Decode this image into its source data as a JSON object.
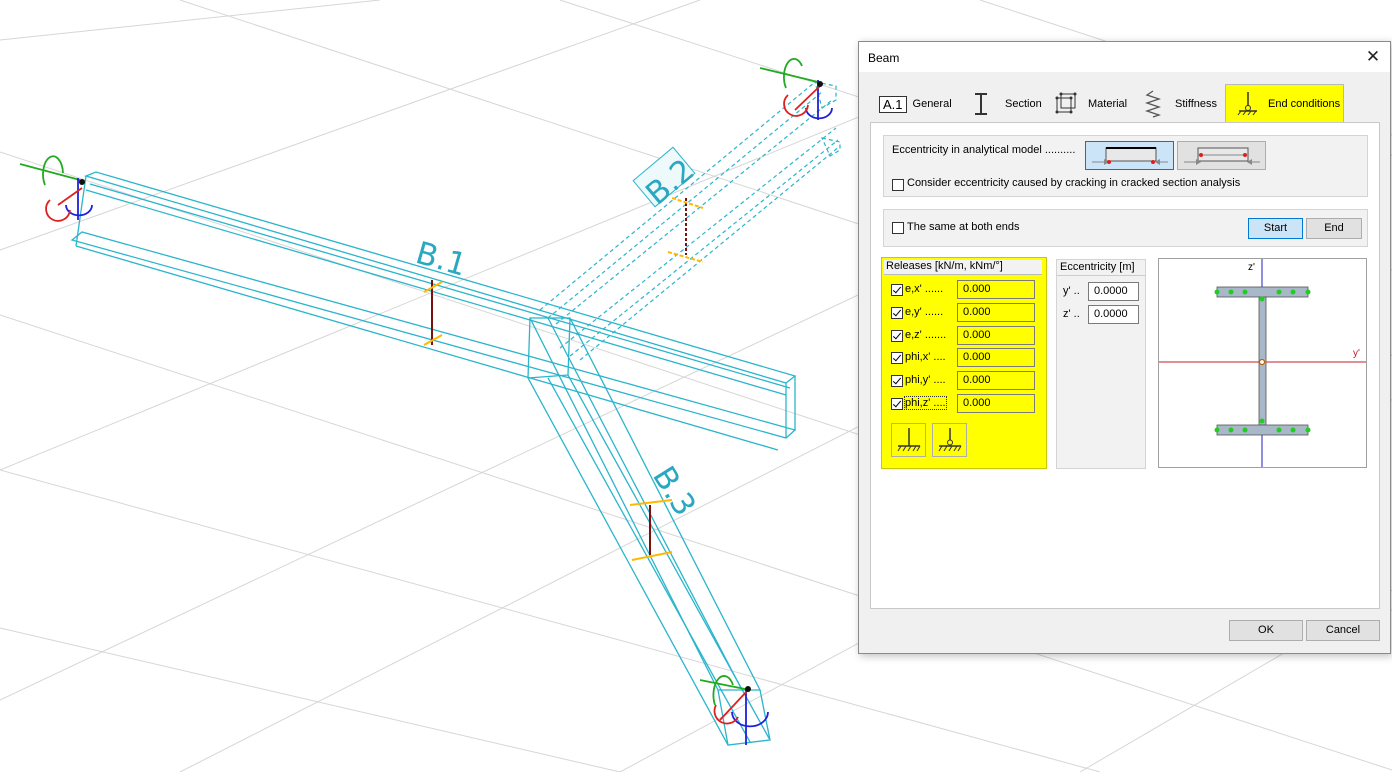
{
  "viewport": {
    "beam_labels": [
      "B.1",
      "B.2",
      "B.3"
    ]
  },
  "dialog": {
    "title": "Beam",
    "close_glyph": "✕",
    "tabs": [
      {
        "badge": "A.1",
        "label": "General",
        "icon": "general-icon"
      },
      {
        "label": "Section",
        "icon": "i-section-icon"
      },
      {
        "label": "Material",
        "icon": "material-cube-icon"
      },
      {
        "label": "Stiffness",
        "icon": "spring-icon"
      },
      {
        "label": "End conditions",
        "icon": "support-icon",
        "active": true
      }
    ],
    "eccentricity_model": {
      "label": "Eccentricity in analytical model ..........",
      "consider_cracking_label": "Consider eccentricity caused by cracking in cracked section analysis",
      "consider_cracking_checked": false,
      "selected_option": 1
    },
    "same_both_ends": {
      "label": "The same at both ends",
      "checked": false,
      "start_label": "Start",
      "end_label": "End",
      "selected": "Start"
    },
    "releases": {
      "header": "Releases [kN/m, kNm/°]",
      "highlight_color": "#ffff00",
      "rows": [
        {
          "label": "e,x' ......",
          "value": "0.000",
          "checked": true
        },
        {
          "label": "e,y' ......",
          "value": "0.000",
          "checked": true
        },
        {
          "label": "e,z' .......",
          "value": "0.000",
          "checked": true
        },
        {
          "label": "phi,x' ....",
          "value": "0.000",
          "checked": true
        },
        {
          "label": "phi,y' ....",
          "value": "0.000",
          "checked": true
        },
        {
          "label": "phi,z' ....",
          "value": "0.000",
          "checked": true
        }
      ]
    },
    "eccentricity": {
      "header": "Eccentricity [m]",
      "rows": [
        {
          "label": "y' ..",
          "value": "0.0000"
        },
        {
          "label": "z' ..",
          "value": "0.0000"
        }
      ]
    },
    "preview": {
      "axis_z": "z'",
      "axis_y": "y'"
    },
    "ok_label": "OK",
    "cancel_label": "Cancel"
  }
}
